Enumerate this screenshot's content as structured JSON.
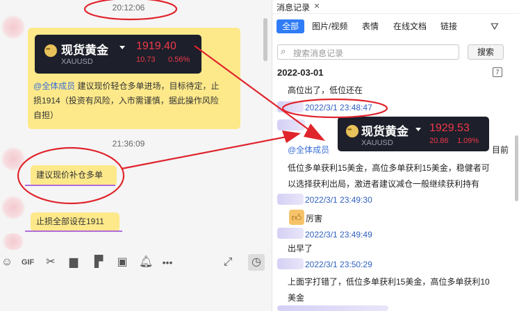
{
  "left": {
    "time1": "20:12:06",
    "card1": {
      "title": "现货黄金",
      "symbol": "XAUUSD",
      "price": "1919.40",
      "change": "10.73",
      "change_pct": "0.56%"
    },
    "msg1_mention": "@全体成员",
    "msg1_line1": " 建议现价轻仓多单进场，目标待定，止",
    "msg1_line2": "损1914（投资有风险，入市需谨慎，据此操作风险",
    "msg1_line3": "自担）",
    "time2": "21:36:09",
    "msg2": "建议现价补仓多单",
    "msg3": "止损全部设在1911"
  },
  "toolbar": {
    "icons": [
      "emoji-icon",
      "gif-icon",
      "scissors-icon",
      "folder-icon",
      "document-icon",
      "image-icon",
      "bell-icon",
      "more-icon",
      "expand-icon",
      "clock-icon"
    ],
    "gif": "GIF"
  },
  "right": {
    "tab_title": "消息记录",
    "close": "×",
    "filters": [
      "全部",
      "图片/视频",
      "表情",
      "在线文档",
      "链接"
    ],
    "search_placeholder": "搜索消息记录",
    "search_button": "搜索",
    "date": "2022-03-01",
    "msg_a": "高位出了，低位还在",
    "time_a": "2022/3/1 23:48:47",
    "card2": {
      "title": "现货黄金",
      "symbol": "XAUUSD",
      "price": "1929.53",
      "change": "20.86",
      "change_pct": "1.09%"
    },
    "mention": "@全体成员",
    "msg_b_tail": "目前",
    "msg_b_line2": "低位多单获利15美金，高位多单获利15美金，稳健者可",
    "msg_b_line3": "以选择获利出局，激进者建议减仓一般继续获利持有",
    "time_b": "2022/3/1 23:49:30",
    "msg_c": "厉害",
    "time_c": "2022/3/1 23:49:49",
    "msg_d": "出早了",
    "time_d": "2022/3/1 23:50:29",
    "msg_e_line1": "上面字打错了，低位多单获利15美金，高位多单获利10",
    "msg_e_line2": "美金"
  },
  "colors": {
    "accent_blue": "#2f7cf6",
    "bubble_yellow": "#fde98a",
    "annotation_red": "#e0242c",
    "price_red": "#f0394a"
  }
}
